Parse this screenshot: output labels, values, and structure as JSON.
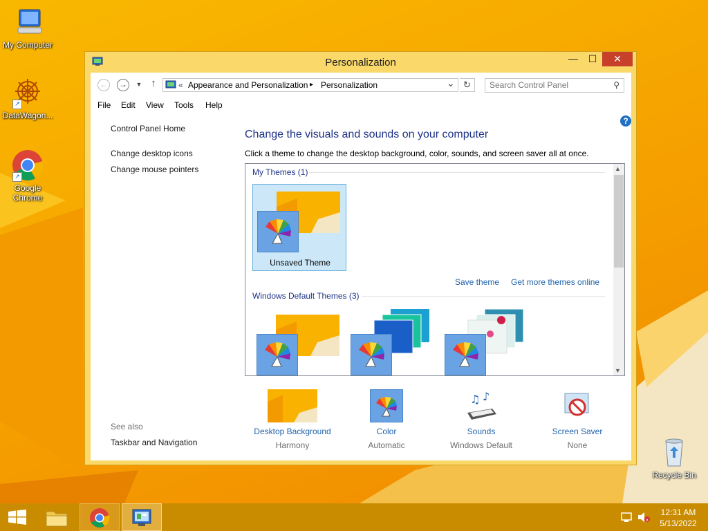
{
  "desktop": {
    "icons": [
      {
        "label": "My Computer"
      },
      {
        "label": "DataWagon..."
      },
      {
        "label": "Google Chrome"
      },
      {
        "label": "Recycle Bin"
      }
    ]
  },
  "window": {
    "title": "Personalization",
    "controls": {
      "minimize": "—",
      "maximize": "☐",
      "close": "✕"
    }
  },
  "address": {
    "chevron": "«",
    "breadcrumb": [
      "Appearance and Personalization",
      "Personalization"
    ],
    "separator": "▸",
    "dropdown": "⌄",
    "search_placeholder": "Search Control Panel"
  },
  "menu": [
    "File",
    "Edit",
    "View",
    "Tools",
    "Help"
  ],
  "left_pane": {
    "home": "Control Panel Home",
    "links": [
      "Change desktop icons",
      "Change mouse pointers"
    ],
    "see_also_label": "See also",
    "see_also_links": [
      "Taskbar and Navigation"
    ]
  },
  "main": {
    "heading": "Change the visuals and sounds on your computer",
    "subtitle": "Click a theme to change the desktop background, color, sounds, and screen saver all at once.",
    "my_themes_title": "My Themes (1)",
    "unsaved_theme": "Unsaved Theme",
    "save_theme": "Save theme",
    "get_more": "Get more themes online",
    "default_themes_title": "Windows Default Themes (3)"
  },
  "settings": [
    {
      "label": "Desktop Background",
      "value": "Harmony"
    },
    {
      "label": "Color",
      "value": "Automatic"
    },
    {
      "label": "Sounds",
      "value": "Windows Default"
    },
    {
      "label": "Screen Saver",
      "value": "None"
    }
  ],
  "taskbar": {
    "time": "12:31 AM",
    "date": "5/13/2022"
  },
  "colors": {
    "accent": "#f9b800",
    "link": "#1f63ac",
    "heading": "#1e3287",
    "close": "#c7402a",
    "selection": "#cce8f8"
  }
}
